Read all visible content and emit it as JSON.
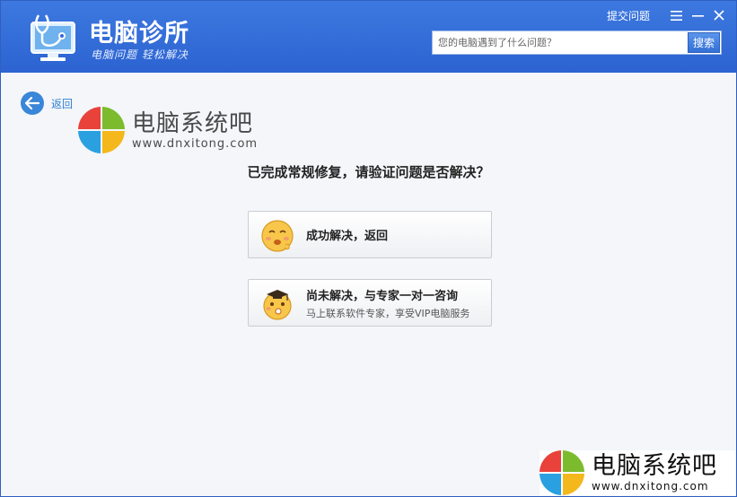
{
  "app": {
    "title": "电脑诊所",
    "slogan": "电脑问题 轻松解决"
  },
  "titlebar": {
    "submit_issue_label": "提交问题",
    "menu_icon": "menu-icon",
    "minimize_icon": "minimize-icon",
    "close_icon": "close-icon"
  },
  "search": {
    "placeholder": "您的电脑遇到了什么问题？",
    "button_label": "搜索"
  },
  "nav": {
    "back_label": "返回"
  },
  "watermark": {
    "name": "电脑系统吧",
    "url": "www.dnxitong.com",
    "colors": [
      "#e8423a",
      "#7cbb2e",
      "#2aa0e0",
      "#f4b81c"
    ]
  },
  "main": {
    "question": "已完成常规修复，请验证问题是否解决？",
    "options": [
      {
        "title": "成功解决，返回",
        "subtitle": ""
      },
      {
        "title": "尚未解决，与专家一对一咨询",
        "subtitle": "马上联系软件专家，享受VIP电脑服务"
      }
    ]
  },
  "colors": {
    "titlebar": "#3068d6",
    "accent": "#3a86d8"
  }
}
